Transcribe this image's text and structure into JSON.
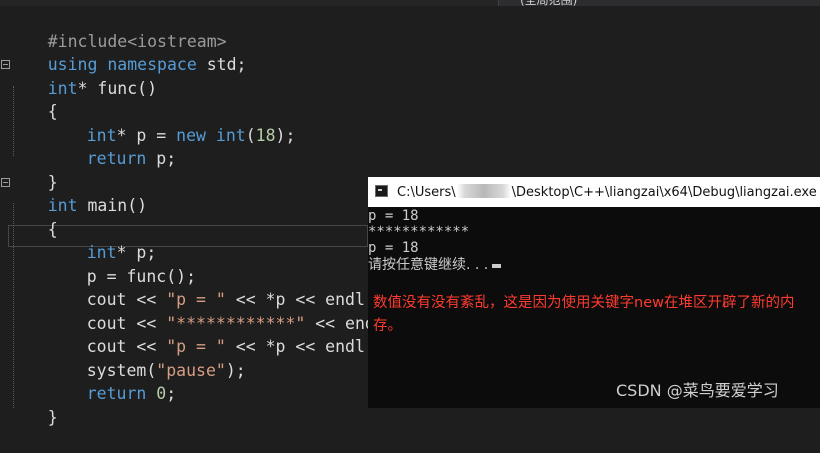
{
  "tab": {
    "label": "(全局范围)"
  },
  "code": {
    "l1": {
      "pp": "#include<iostream>"
    },
    "l2": {
      "k1": "using",
      "k2": "namespace",
      "rest": " std;"
    },
    "l3": {
      "k": "int",
      "rest": "* func()"
    },
    "l4": {
      "text": "{"
    },
    "l5": {
      "k1": "int",
      "a": "* p = ",
      "k2": "new",
      "sp": " ",
      "k3": "int",
      "b": "(",
      "n": "18",
      "c": ");"
    },
    "l6": {
      "k": "return",
      "rest": " p;"
    },
    "l7": {
      "text": "}"
    },
    "l8": {
      "k": "int",
      "rest": " main()"
    },
    "l9": {
      "text": "{"
    },
    "l10": {
      "k": "int",
      "rest": "* p;"
    },
    "l11": {
      "text": "p = func();"
    },
    "l12": {
      "a": "cout << ",
      "s": "\"p = \"",
      "b": " << *p << endl;"
    },
    "l13": {
      "a": "cout << ",
      "s": "\"************\"",
      "b": " << endl;"
    },
    "l14": {
      "a": "cout << ",
      "s": "\"p = \"",
      "b": " << *p << endl;"
    },
    "l15": {
      "a": "system(",
      "s": "\"pause\"",
      "b": ");"
    },
    "l16": {
      "k": "return",
      "sp": " ",
      "n": "0",
      "b": ";"
    },
    "l17": {
      "text": "}"
    }
  },
  "console": {
    "title_prefix": "C:\\Users\\",
    "title_suffix": "\\Desktop\\C++\\liangzai\\x64\\Debug\\liangzai.exe",
    "lines": [
      "p = 18",
      "************",
      "p = 18",
      "请按任意键继续. . ."
    ],
    "note": "数值没有没有紊乱，这是因为使用关键字new在堆区开辟了新的内存。"
  },
  "watermark": "CSDN @菜鸟要爱学习",
  "colors": {
    "keyword": "#569cd6",
    "number": "#b5cea8",
    "string": "#d69d85",
    "note": "#ff3b2f"
  }
}
